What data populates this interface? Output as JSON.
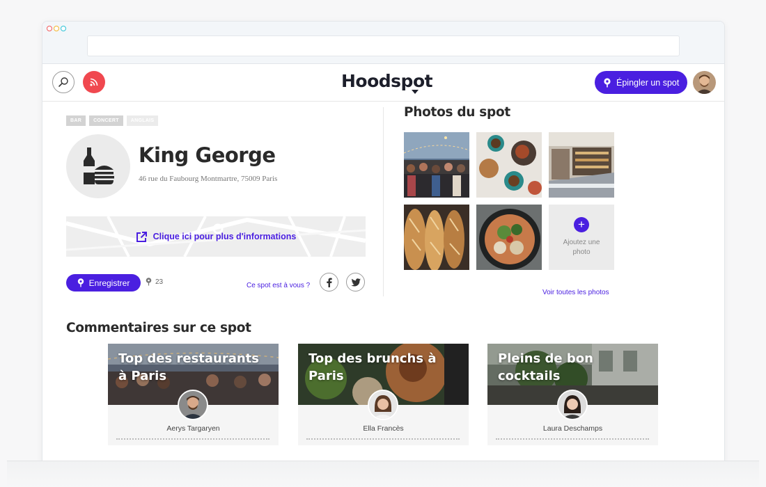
{
  "header": {
    "logo_text": "Hoodspot",
    "pin_button_label": "Épingler un spot"
  },
  "spot": {
    "tags": [
      "BAR",
      "CONCERT",
      "ANGLAIS"
    ],
    "name": "King George",
    "address": "46 rue du Faubourg Montmartre, 75009 Paris",
    "info_link": "Clique ici pour plus d'informations",
    "save_label": "Enregistrer",
    "save_count": "23",
    "owner_link": "Ce spot est à vous ?"
  },
  "photos": {
    "title": "Photos du spot",
    "add_label": "Ajoutez une photo",
    "see_all": "Voir toutes les photos"
  },
  "comments": {
    "title": "Commentaires sur ce spot",
    "cards": [
      {
        "title": "Top des restaurants à Paris",
        "author": "Aerys Targaryen"
      },
      {
        "title": "Top des brunchs à Paris",
        "author": "Ella Francès"
      },
      {
        "title": "Pleins de bon cocktails",
        "author": "Laura Deschamps"
      }
    ]
  },
  "colors": {
    "accent": "#4a1fe0",
    "rss": "#f0484f",
    "logo": "#1d1f2b"
  },
  "icons": [
    "search-icon",
    "rss-icon",
    "pin-icon",
    "bottle-burger-icon",
    "external-link-icon",
    "facebook-icon",
    "twitter-icon",
    "plus-icon"
  ]
}
